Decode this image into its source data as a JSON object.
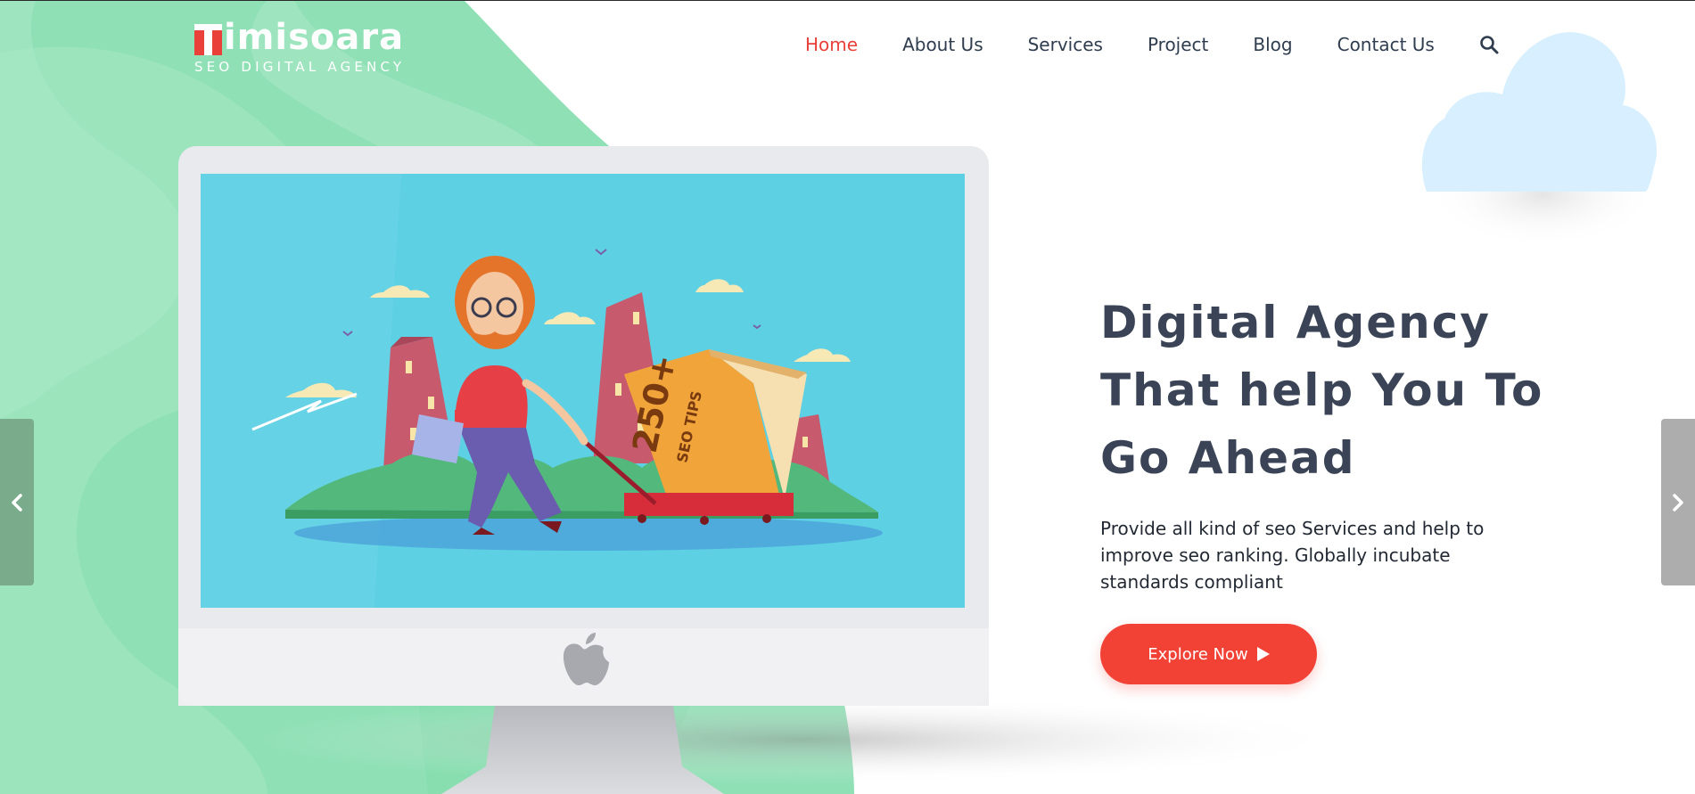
{
  "brand": {
    "name": "imisoara",
    "tagline": "SEO DIGITAL AGENCY",
    "accent_color": "#e9403a",
    "green_color": "#8fe0b5"
  },
  "nav": {
    "items": [
      "Home",
      "About Us",
      "Services",
      "Project",
      "Blog",
      "Contact Us"
    ],
    "active": "Home",
    "search_icon": "search-icon"
  },
  "hero": {
    "title_line1": "Digital Agency",
    "title_line2": "That help You To",
    "title_line3": "Go Ahead",
    "description": "Provide all kind of seo Services and help to improve seo ranking. Globally incubate standards compliant",
    "cta_label": "Explore Now",
    "cta_icon": "play-icon"
  },
  "illustration": {
    "book_label_big": "250+",
    "book_label_small": "SEO TIPS"
  },
  "slider": {
    "prev_icon": "chevron-left-icon",
    "next_icon": "chevron-right-icon"
  }
}
